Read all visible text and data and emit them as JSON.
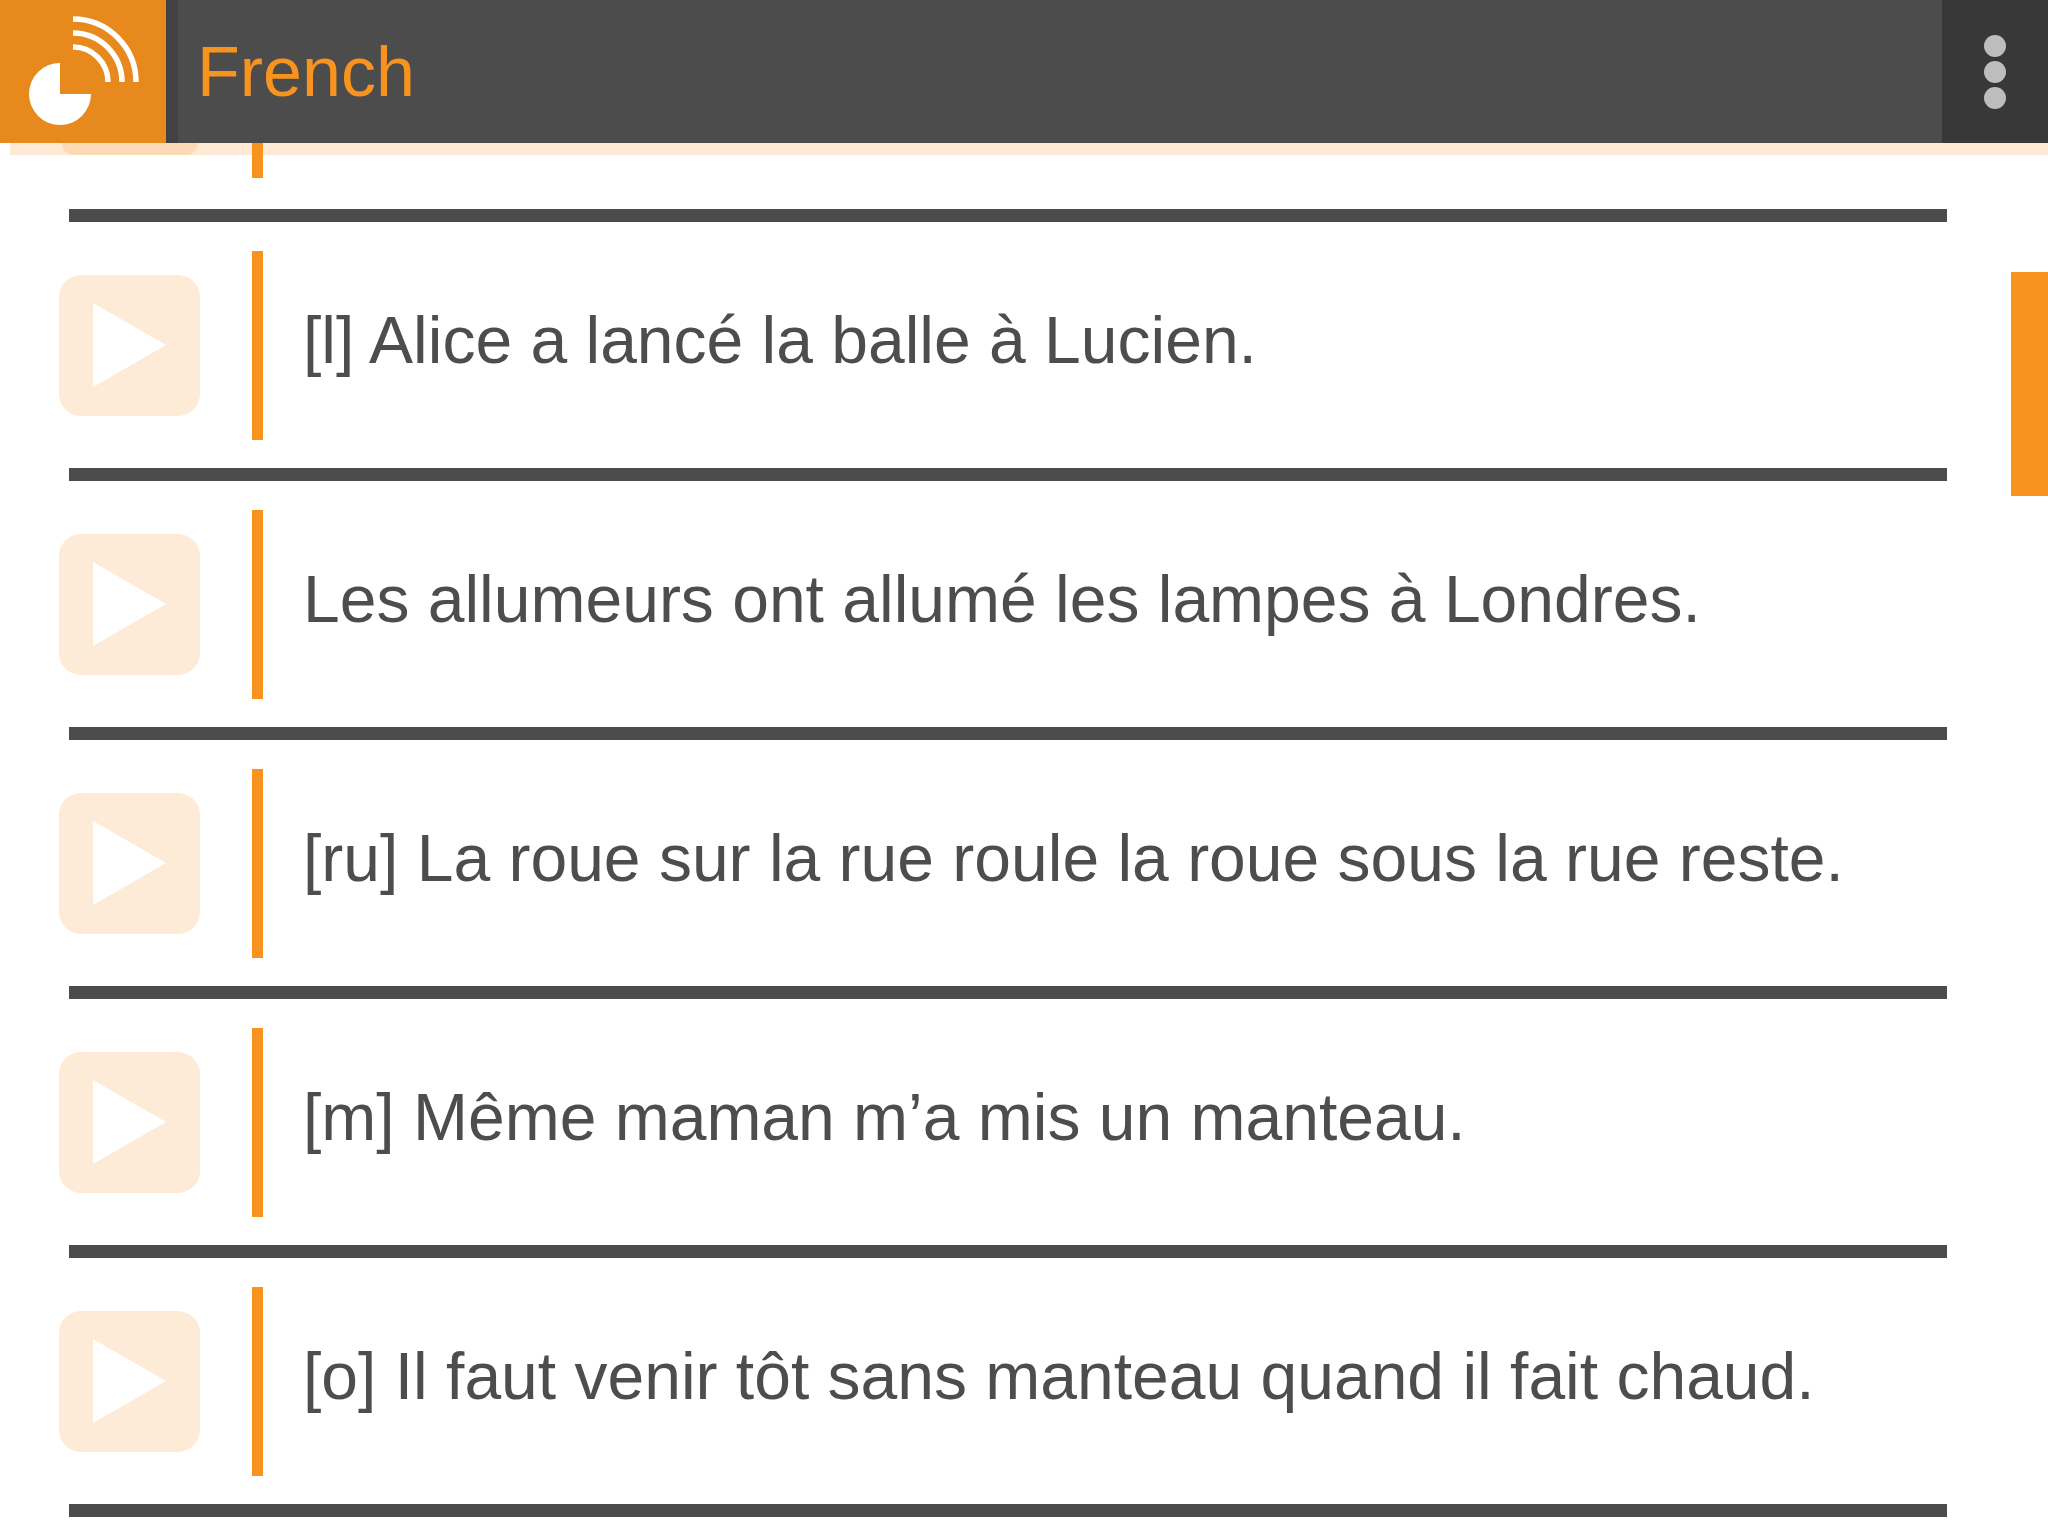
{
  "app_bar": {
    "title": "French"
  },
  "phrases": [
    {
      "text": "[l] Alice a lancé la balle à Lucien."
    },
    {
      "text": "Les allumeurs ont allumé les lampes à Londres."
    },
    {
      "text": "[ru] La roue sur la rue roule la roue sous la rue reste."
    },
    {
      "text": "[m] Même maman m’a mis un manteau."
    },
    {
      "text": "[o] Il faut venir tôt sans manteau quand il fait chaud."
    }
  ]
}
